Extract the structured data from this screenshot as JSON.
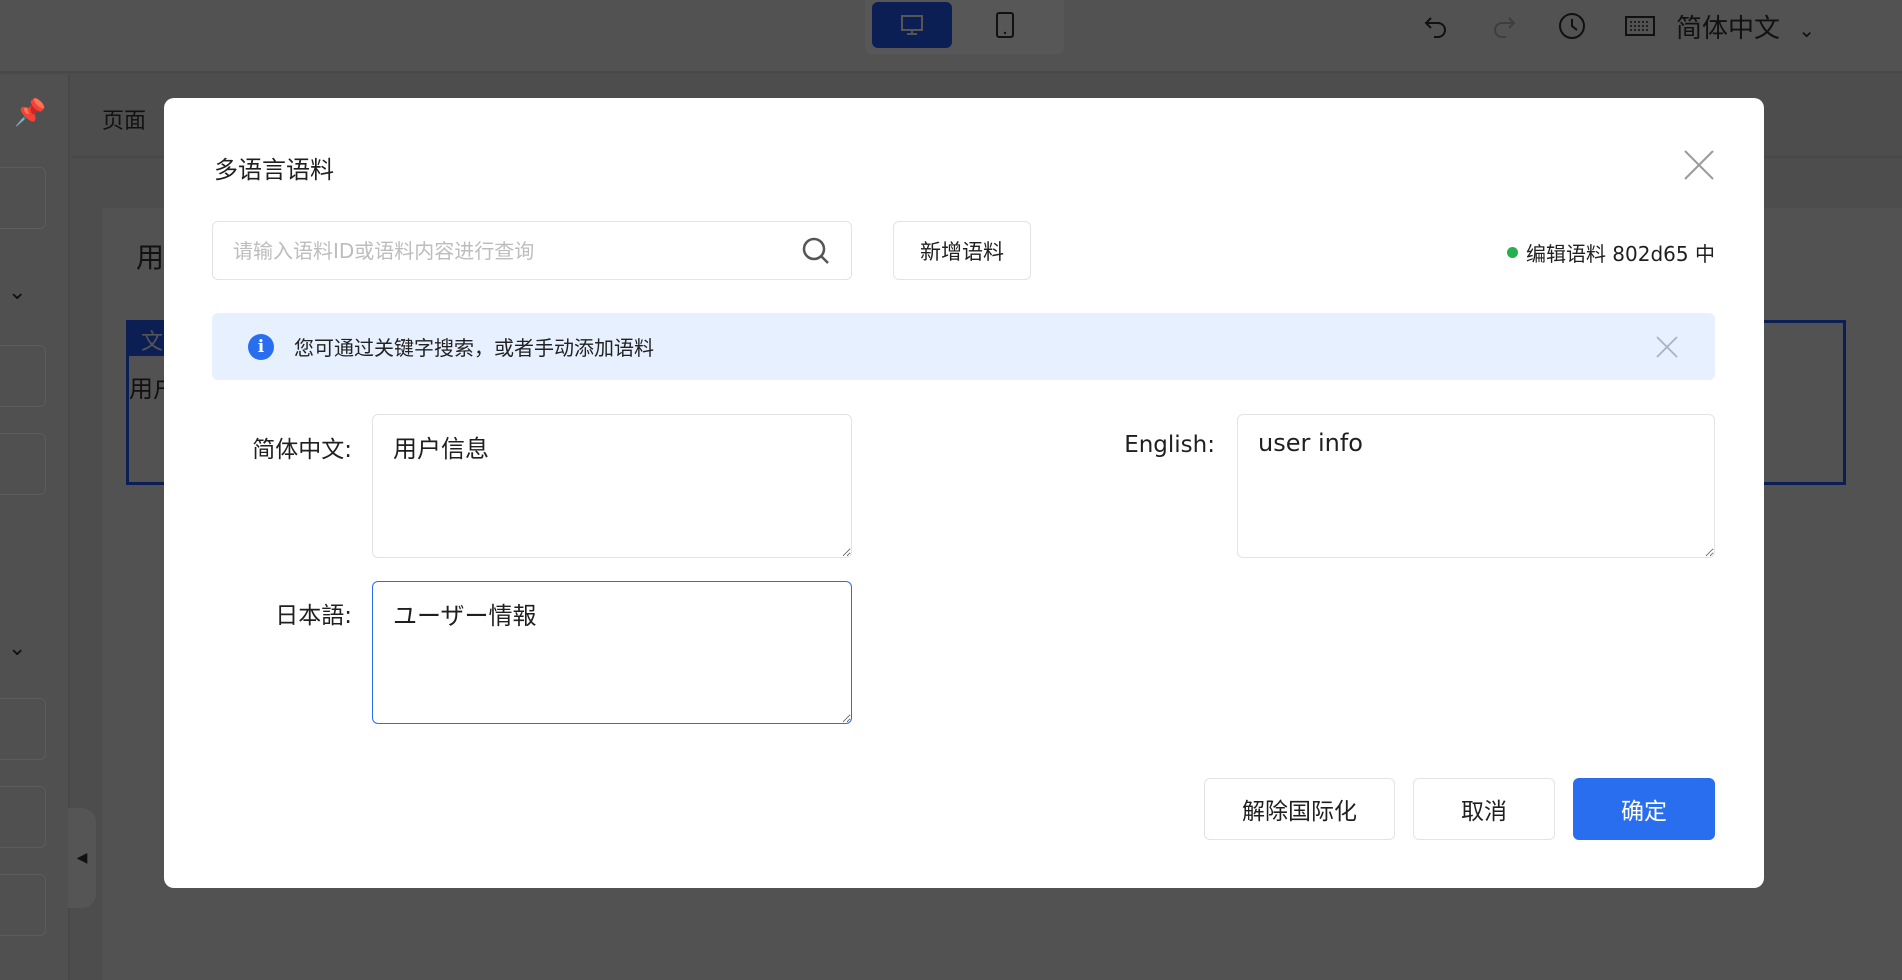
{
  "topbar": {
    "language": "简体中文",
    "icons": [
      "desktop-icon",
      "tablet-icon",
      "undo-icon",
      "redo-icon",
      "history-icon",
      "keyboard-icon",
      "chevron-down-icon"
    ]
  },
  "background": {
    "page_tab": "页面",
    "panel_title": "用",
    "table_header": "文",
    "table_cell": "用户"
  },
  "modal": {
    "title": "多语言语料",
    "search_placeholder": "请输入语料ID或语料内容进行查询",
    "add_button": "新增语料",
    "status": "编辑语料 802d65 中",
    "status_color": "#22b14c",
    "info": "您可通过关键字搜索，或者手动添加语料",
    "fields": [
      {
        "label": "简体中文:",
        "value": "用户信息"
      },
      {
        "label": "English:",
        "value": "user info"
      },
      {
        "label": "日本語:",
        "value": "ユーザー情報"
      }
    ],
    "buttons": {
      "remove_i18n": "解除国际化",
      "cancel": "取消",
      "confirm": "确定"
    },
    "accent_color": "#2a6ef0"
  }
}
